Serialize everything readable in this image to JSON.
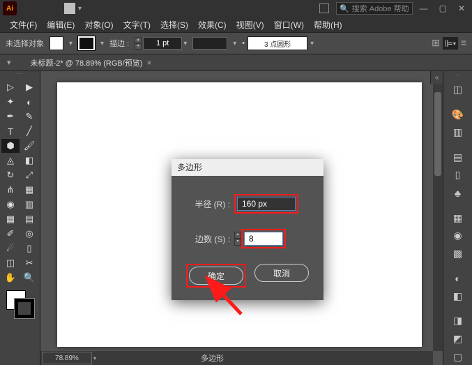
{
  "titlebar": {
    "app_abbrev": "Ai",
    "search_placeholder": "搜索 Adobe 帮助"
  },
  "menu": {
    "file": "文件(F)",
    "edit": "编辑(E)",
    "object": "对象(O)",
    "type": "文字(T)",
    "select": "选择(S)",
    "effect": "效果(C)",
    "view": "视图(V)",
    "window": "窗口(W)",
    "help": "帮助(H)"
  },
  "ctrl": {
    "no_selection": "未选择对象",
    "stroke_label": "描边 :",
    "weight": "1 pt",
    "style": "3 点圆形",
    "bullet": "•"
  },
  "tab": {
    "doc": "未标题-2* @ 78.89% (RGB/预览)"
  },
  "status": {
    "zoom": "78.89%",
    "tool": "多边形"
  },
  "dialog": {
    "title": "多边形",
    "radius_label": "半径 (R) :",
    "radius_value": "160 px",
    "sides_label": "边数 (S) :",
    "sides_value": "8",
    "ok": "确定",
    "cancel": "取消"
  },
  "chevron_left": "«"
}
